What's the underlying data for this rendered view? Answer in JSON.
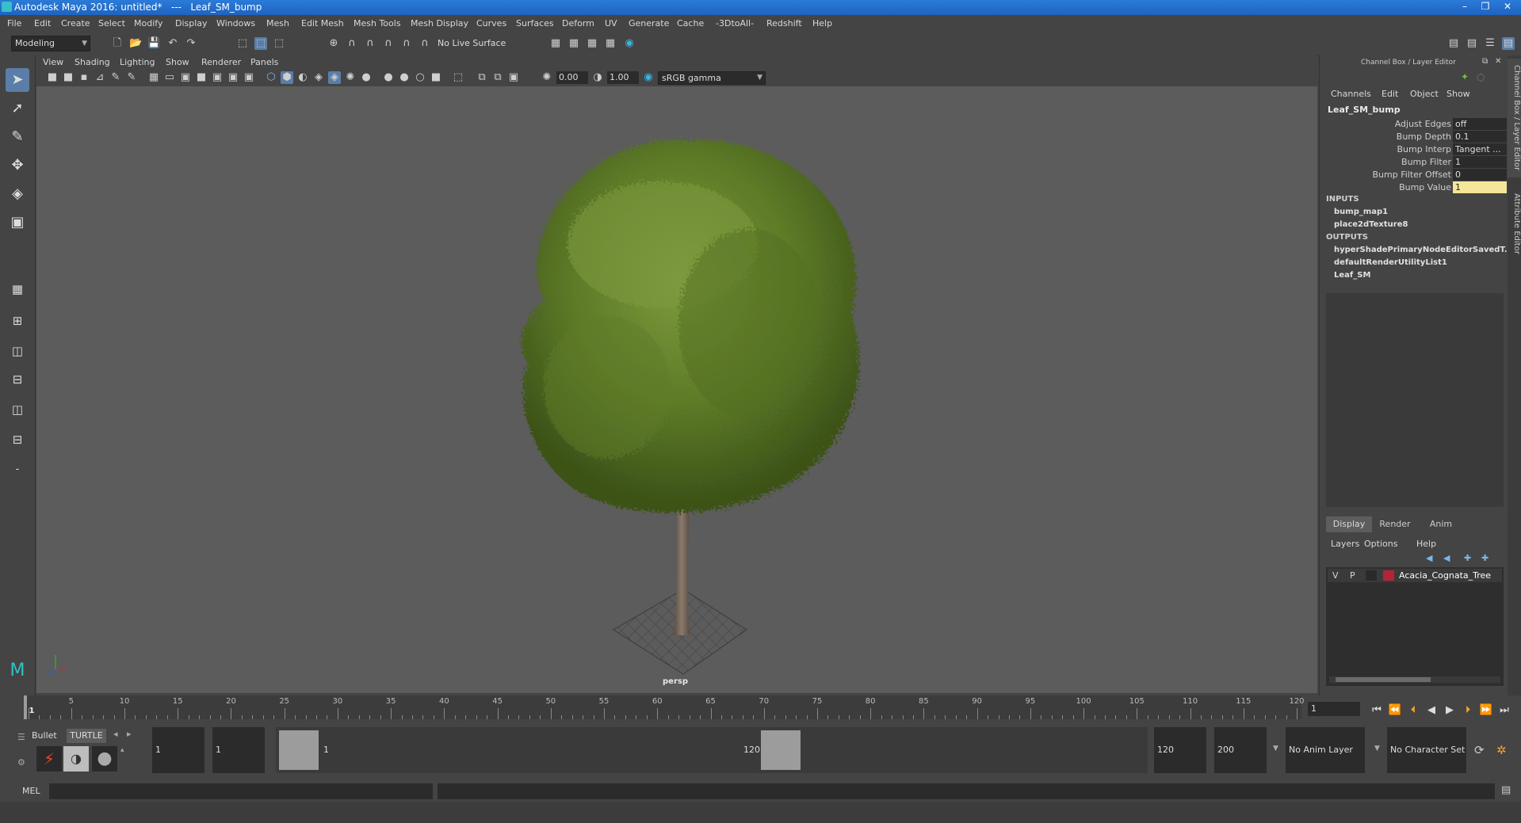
{
  "window": {
    "title": "Autodesk Maya 2016: untitled*   ---   Leaf_SM_bump",
    "minimize": "–",
    "restore": "❐",
    "close": "✕"
  },
  "menu": [
    "File",
    "Edit",
    "Create",
    "Select",
    "Modify",
    "Display",
    "Windows",
    "Mesh",
    "Edit Mesh",
    "Mesh Tools",
    "Mesh Display",
    "Curves",
    "Surfaces",
    "Deform",
    "UV",
    "Generate",
    "Cache",
    "-3DtoAll-",
    "Redshift",
    "Help"
  ],
  "shelf": {
    "mode_dropdown": "Modeling",
    "live_surface": "No Live Surface"
  },
  "viewport_menu": [
    "View",
    "Shading",
    "Lighting",
    "Show",
    "Renderer",
    "Panels"
  ],
  "viewport_tools": {
    "field1": "0.00",
    "field2": "1.00",
    "colorspace": "sRGB gamma"
  },
  "viewport": {
    "camera_label": "persp"
  },
  "channel_box": {
    "header": "Channel Box / Layer Editor",
    "tabs": [
      "Channels",
      "Edit",
      "Object",
      "Show"
    ],
    "node_name": "Leaf_SM_bump",
    "attributes": [
      {
        "label": "Adjust Edges",
        "value": "off"
      },
      {
        "label": "Bump Depth",
        "value": "0.1"
      },
      {
        "label": "Bump Interp",
        "value": "Tangent ..."
      },
      {
        "label": "Bump Filter",
        "value": "1"
      },
      {
        "label": "Bump Filter Offset",
        "value": "0"
      },
      {
        "label": "Bump Value",
        "value": "1"
      }
    ],
    "inputs_label": "INPUTS",
    "inputs": [
      "bump_map1",
      "place2dTexture8"
    ],
    "outputs_label": "OUTPUTS",
    "outputs": [
      "hyperShadePrimaryNodeEditorSavedT...",
      "defaultRenderUtilityList1",
      "Leaf_SM"
    ]
  },
  "layer_editor": {
    "tabs": [
      "Display",
      "Render",
      "Anim"
    ],
    "menu": [
      "Layers",
      "Options",
      "Help"
    ],
    "layer": {
      "v": "V",
      "p": "P",
      "name": "Acacia_Cognata_Tree",
      "color": "#b3243c"
    }
  },
  "side_tabs": [
    "Channel Box / Layer Editor",
    "Attribute Editor"
  ],
  "timeline": {
    "ticks": [
      1,
      5,
      10,
      15,
      20,
      25,
      30,
      35,
      40,
      45,
      50,
      55,
      60,
      65,
      70,
      75,
      80,
      85,
      90,
      95,
      100,
      105,
      110,
      115,
      120
    ],
    "current_frame": "1"
  },
  "range": {
    "shelf_tabs": [
      "Bullet",
      "TURTLE"
    ],
    "start": "1",
    "playback_start": "1",
    "slider_start_label": "1",
    "slider_end_label": "120",
    "playback_end": "120",
    "end": "200",
    "anim_layer": "No Anim Layer",
    "character_set": "No Character Set"
  },
  "command_line": {
    "label": "MEL"
  }
}
